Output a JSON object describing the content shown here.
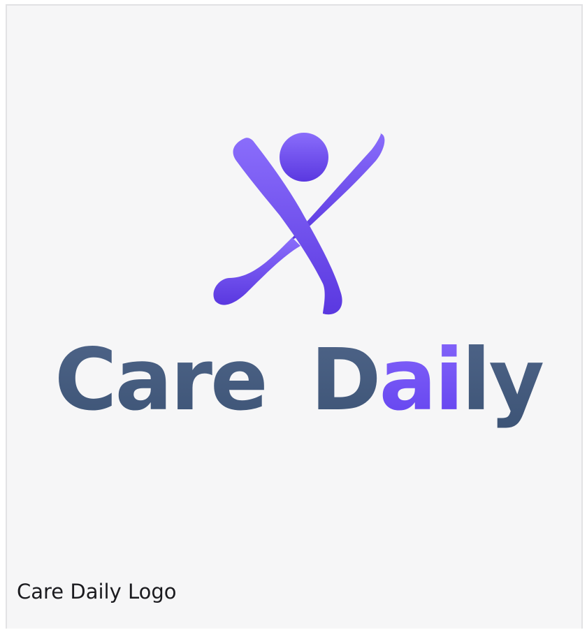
{
  "logo": {
    "word1": "Care",
    "word2_part1": "D",
    "word2_part2": "ai",
    "word2_part3": "ly"
  },
  "caption": "Care Daily Logo",
  "colors": {
    "background": "#f6f6f7",
    "border": "#e2e2e4",
    "figure_top": "#8a6dfb",
    "figure_bottom": "#5a38e0",
    "wordmark_slate": "#445b7e",
    "wordmark_accent": "#6e4ff5",
    "caption_text": "#1b1b1f"
  },
  "icons": {
    "figure": "jumping-person-icon"
  }
}
